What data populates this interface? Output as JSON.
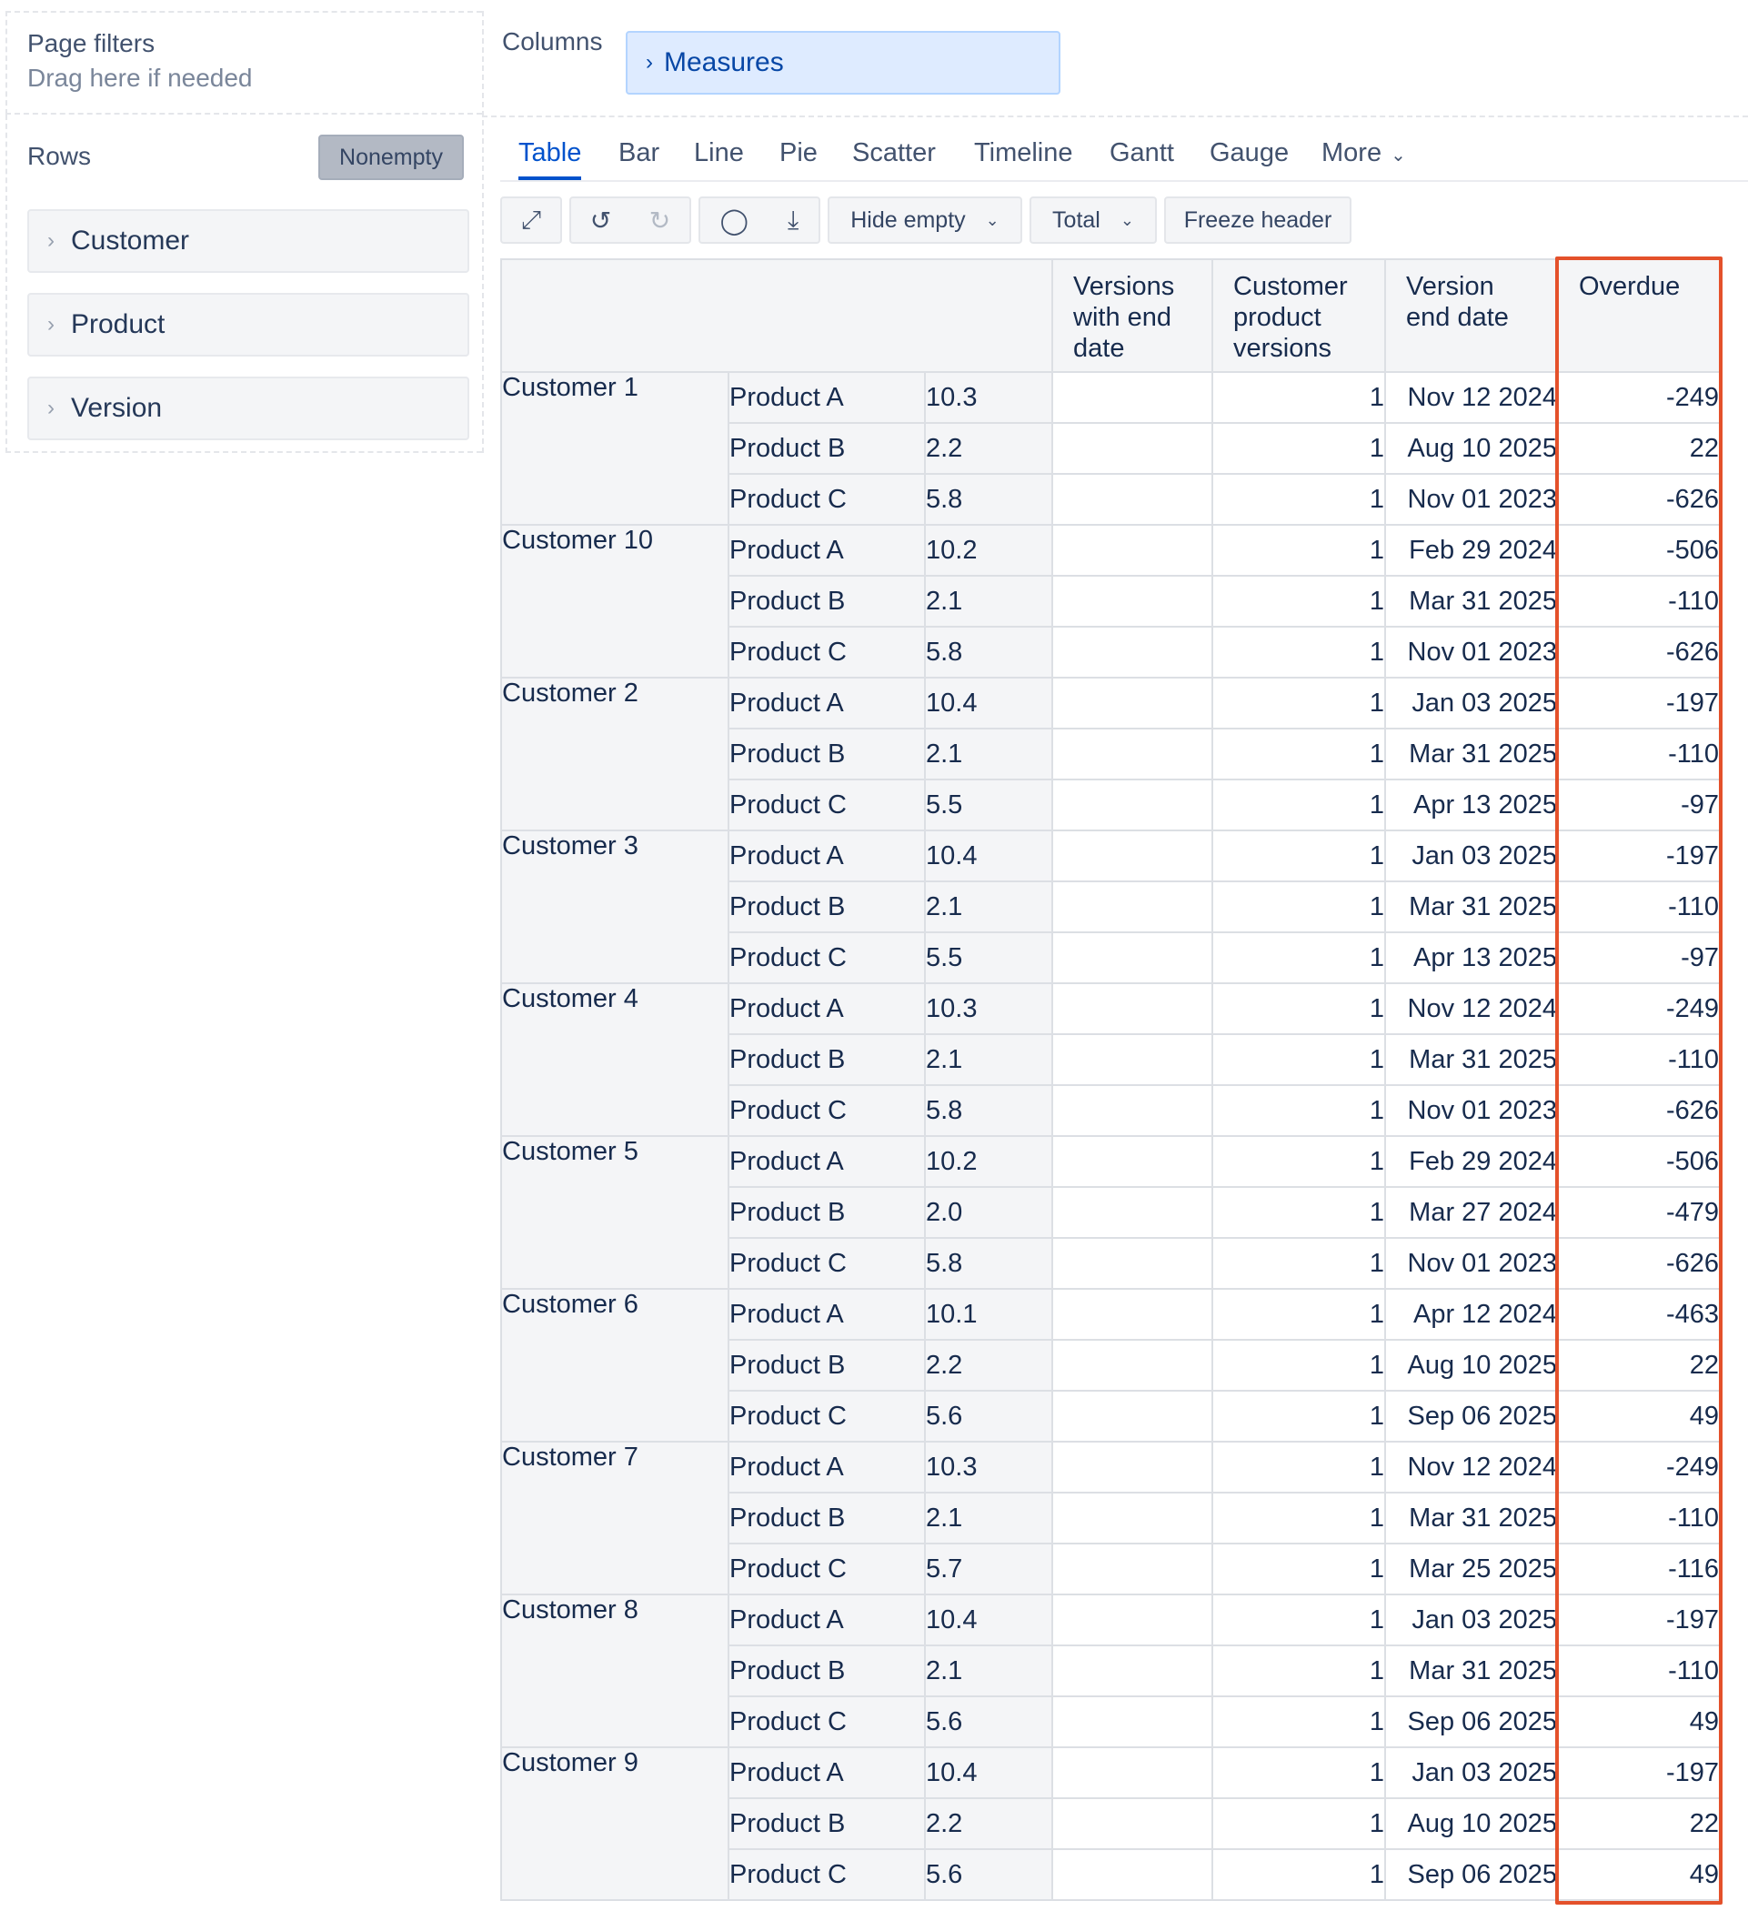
{
  "page_filters": {
    "title": "Page filters",
    "hint": "Drag here if needed"
  },
  "rows_panel": {
    "title": "Rows",
    "nonempty_label": "Nonempty",
    "items": [
      {
        "label": "Customer"
      },
      {
        "label": "Product"
      },
      {
        "label": "Version"
      }
    ]
  },
  "columns_panel": {
    "title": "Columns",
    "measures_label": "Measures"
  },
  "tabs": [
    {
      "label": "Table",
      "active": true
    },
    {
      "label": "Bar"
    },
    {
      "label": "Line"
    },
    {
      "label": "Pie"
    },
    {
      "label": "Scatter"
    },
    {
      "label": "Timeline"
    },
    {
      "label": "Gantt"
    },
    {
      "label": "Gauge"
    },
    {
      "label": "More"
    }
  ],
  "toolbar": {
    "hide_empty_label": "Hide empty",
    "total_label": "Total",
    "freeze_header_label": "Freeze header"
  },
  "table": {
    "headers": [
      "Versions with end date",
      "Customer product versions",
      "Version end date",
      "Overdue"
    ],
    "groups": [
      {
        "customer": "Customer 1",
        "rows": [
          {
            "product": "Product A",
            "version": "10.3",
            "versions_with_end_date": "",
            "customer_product_versions": "1",
            "version_end_date": "Nov 12 2024",
            "overdue": "-249"
          },
          {
            "product": "Product B",
            "version": "2.2",
            "versions_with_end_date": "",
            "customer_product_versions": "1",
            "version_end_date": "Aug 10 2025",
            "overdue": "22"
          },
          {
            "product": "Product C",
            "version": "5.8",
            "versions_with_end_date": "",
            "customer_product_versions": "1",
            "version_end_date": "Nov 01 2023",
            "overdue": "-626"
          }
        ]
      },
      {
        "customer": "Customer 10",
        "rows": [
          {
            "product": "Product A",
            "version": "10.2",
            "versions_with_end_date": "",
            "customer_product_versions": "1",
            "version_end_date": "Feb 29 2024",
            "overdue": "-506"
          },
          {
            "product": "Product B",
            "version": "2.1",
            "versions_with_end_date": "",
            "customer_product_versions": "1",
            "version_end_date": "Mar 31 2025",
            "overdue": "-110"
          },
          {
            "product": "Product C",
            "version": "5.8",
            "versions_with_end_date": "",
            "customer_product_versions": "1",
            "version_end_date": "Nov 01 2023",
            "overdue": "-626"
          }
        ]
      },
      {
        "customer": "Customer 2",
        "rows": [
          {
            "product": "Product A",
            "version": "10.4",
            "versions_with_end_date": "",
            "customer_product_versions": "1",
            "version_end_date": "Jan 03 2025",
            "overdue": "-197"
          },
          {
            "product": "Product B",
            "version": "2.1",
            "versions_with_end_date": "",
            "customer_product_versions": "1",
            "version_end_date": "Mar 31 2025",
            "overdue": "-110"
          },
          {
            "product": "Product C",
            "version": "5.5",
            "versions_with_end_date": "",
            "customer_product_versions": "1",
            "version_end_date": "Apr 13 2025",
            "overdue": "-97"
          }
        ]
      },
      {
        "customer": "Customer 3",
        "rows": [
          {
            "product": "Product A",
            "version": "10.4",
            "versions_with_end_date": "",
            "customer_product_versions": "1",
            "version_end_date": "Jan 03 2025",
            "overdue": "-197"
          },
          {
            "product": "Product B",
            "version": "2.1",
            "versions_with_end_date": "",
            "customer_product_versions": "1",
            "version_end_date": "Mar 31 2025",
            "overdue": "-110"
          },
          {
            "product": "Product C",
            "version": "5.5",
            "versions_with_end_date": "",
            "customer_product_versions": "1",
            "version_end_date": "Apr 13 2025",
            "overdue": "-97"
          }
        ]
      },
      {
        "customer": "Customer 4",
        "rows": [
          {
            "product": "Product A",
            "version": "10.3",
            "versions_with_end_date": "",
            "customer_product_versions": "1",
            "version_end_date": "Nov 12 2024",
            "overdue": "-249"
          },
          {
            "product": "Product B",
            "version": "2.1",
            "versions_with_end_date": "",
            "customer_product_versions": "1",
            "version_end_date": "Mar 31 2025",
            "overdue": "-110"
          },
          {
            "product": "Product C",
            "version": "5.8",
            "versions_with_end_date": "",
            "customer_product_versions": "1",
            "version_end_date": "Nov 01 2023",
            "overdue": "-626"
          }
        ]
      },
      {
        "customer": "Customer 5",
        "rows": [
          {
            "product": "Product A",
            "version": "10.2",
            "versions_with_end_date": "",
            "customer_product_versions": "1",
            "version_end_date": "Feb 29 2024",
            "overdue": "-506"
          },
          {
            "product": "Product B",
            "version": "2.0",
            "versions_with_end_date": "",
            "customer_product_versions": "1",
            "version_end_date": "Mar 27 2024",
            "overdue": "-479"
          },
          {
            "product": "Product C",
            "version": "5.8",
            "versions_with_end_date": "",
            "customer_product_versions": "1",
            "version_end_date": "Nov 01 2023",
            "overdue": "-626"
          }
        ]
      },
      {
        "customer": "Customer 6",
        "rows": [
          {
            "product": "Product A",
            "version": "10.1",
            "versions_with_end_date": "",
            "customer_product_versions": "1",
            "version_end_date": "Apr 12 2024",
            "overdue": "-463"
          },
          {
            "product": "Product B",
            "version": "2.2",
            "versions_with_end_date": "",
            "customer_product_versions": "1",
            "version_end_date": "Aug 10 2025",
            "overdue": "22"
          },
          {
            "product": "Product C",
            "version": "5.6",
            "versions_with_end_date": "",
            "customer_product_versions": "1",
            "version_end_date": "Sep 06 2025",
            "overdue": "49"
          }
        ]
      },
      {
        "customer": "Customer 7",
        "rows": [
          {
            "product": "Product A",
            "version": "10.3",
            "versions_with_end_date": "",
            "customer_product_versions": "1",
            "version_end_date": "Nov 12 2024",
            "overdue": "-249"
          },
          {
            "product": "Product B",
            "version": "2.1",
            "versions_with_end_date": "",
            "customer_product_versions": "1",
            "version_end_date": "Mar 31 2025",
            "overdue": "-110"
          },
          {
            "product": "Product C",
            "version": "5.7",
            "versions_with_end_date": "",
            "customer_product_versions": "1",
            "version_end_date": "Mar 25 2025",
            "overdue": "-116"
          }
        ]
      },
      {
        "customer": "Customer 8",
        "rows": [
          {
            "product": "Product A",
            "version": "10.4",
            "versions_with_end_date": "",
            "customer_product_versions": "1",
            "version_end_date": "Jan 03 2025",
            "overdue": "-197"
          },
          {
            "product": "Product B",
            "version": "2.1",
            "versions_with_end_date": "",
            "customer_product_versions": "1",
            "version_end_date": "Mar 31 2025",
            "overdue": "-110"
          },
          {
            "product": "Product C",
            "version": "5.6",
            "versions_with_end_date": "",
            "customer_product_versions": "1",
            "version_end_date": "Sep 06 2025",
            "overdue": "49"
          }
        ]
      },
      {
        "customer": "Customer 9",
        "rows": [
          {
            "product": "Product A",
            "version": "10.4",
            "versions_with_end_date": "",
            "customer_product_versions": "1",
            "version_end_date": "Jan 03 2025",
            "overdue": "-197"
          },
          {
            "product": "Product B",
            "version": "2.2",
            "versions_with_end_date": "",
            "customer_product_versions": "1",
            "version_end_date": "Aug 10 2025",
            "overdue": "22"
          },
          {
            "product": "Product C",
            "version": "5.6",
            "versions_with_end_date": "",
            "customer_product_versions": "1",
            "version_end_date": "Sep 06 2025",
            "overdue": "49"
          }
        ]
      }
    ]
  },
  "colors": {
    "accent": "#0052cc",
    "highlight": "#e4512b",
    "chip_bg": "#deebff"
  },
  "icons": {
    "fullscreen": "fullscreen-icon",
    "undo": "undo-icon",
    "redo": "redo-icon",
    "comment": "comment-icon",
    "export": "export-icon"
  }
}
